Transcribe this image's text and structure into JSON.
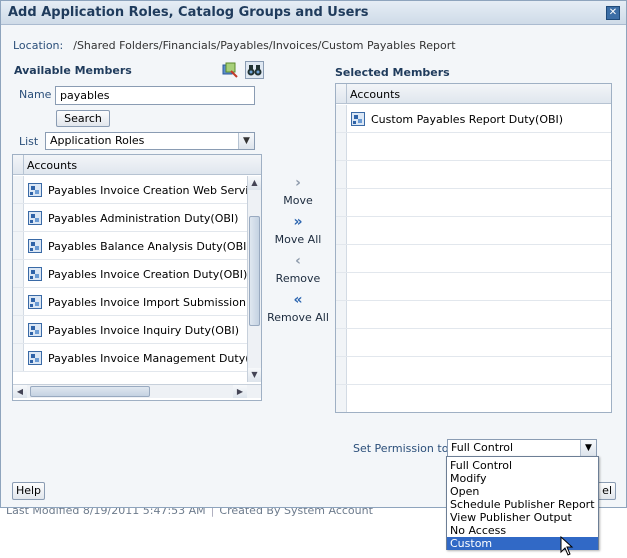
{
  "dialog": {
    "title": "Add Application Roles, Catalog Groups and Users",
    "close_glyph": "✕"
  },
  "location": {
    "label": "Location:",
    "path": "/Shared Folders/Financials/Payables/Invoices/Custom Payables Report"
  },
  "available": {
    "heading": "Available Members",
    "icons": [
      "search-options-icon",
      "binoculars-icon"
    ],
    "name_label": "Name",
    "name_value": "payables",
    "search_label": "Search",
    "list_label": "List",
    "list_value": "Application Roles",
    "table_header": "Accounts",
    "rows": [
      "Payables Invoice Creation Web Service D",
      "Payables Administration Duty(OBI)",
      "Payables Balance Analysis Duty(OBI)",
      "Payables Invoice Creation Duty(OBI)",
      "Payables Invoice Import Submission Duty",
      "Payables Invoice Inquiry Duty(OBI)",
      "Payables Invoice Management Duty(OBI"
    ]
  },
  "shuttle": {
    "move": "Move",
    "move_all": "Move All",
    "remove": "Remove",
    "remove_all": "Remove All"
  },
  "selected": {
    "heading": "Selected Members",
    "table_header": "Accounts",
    "rows": [
      "Custom Payables Report Duty(OBI)"
    ]
  },
  "permission": {
    "label": "Set Permission to",
    "value": "Full Control",
    "options": [
      "Full Control",
      "Modify",
      "Open",
      "Schedule Publisher Report",
      "View Publisher Output",
      "No Access",
      "Custom"
    ],
    "highlighted": "Custom"
  },
  "footer": {
    "help": "Help",
    "cancel_partial": "el",
    "last_modified": "Last Modified 8/19/2011 5:47:53 AM",
    "created_by": "Created By System Account"
  },
  "colors": {
    "accent": "#3169c6",
    "title_text": "#1f3b5c",
    "label_text": "#2b4f7a"
  }
}
